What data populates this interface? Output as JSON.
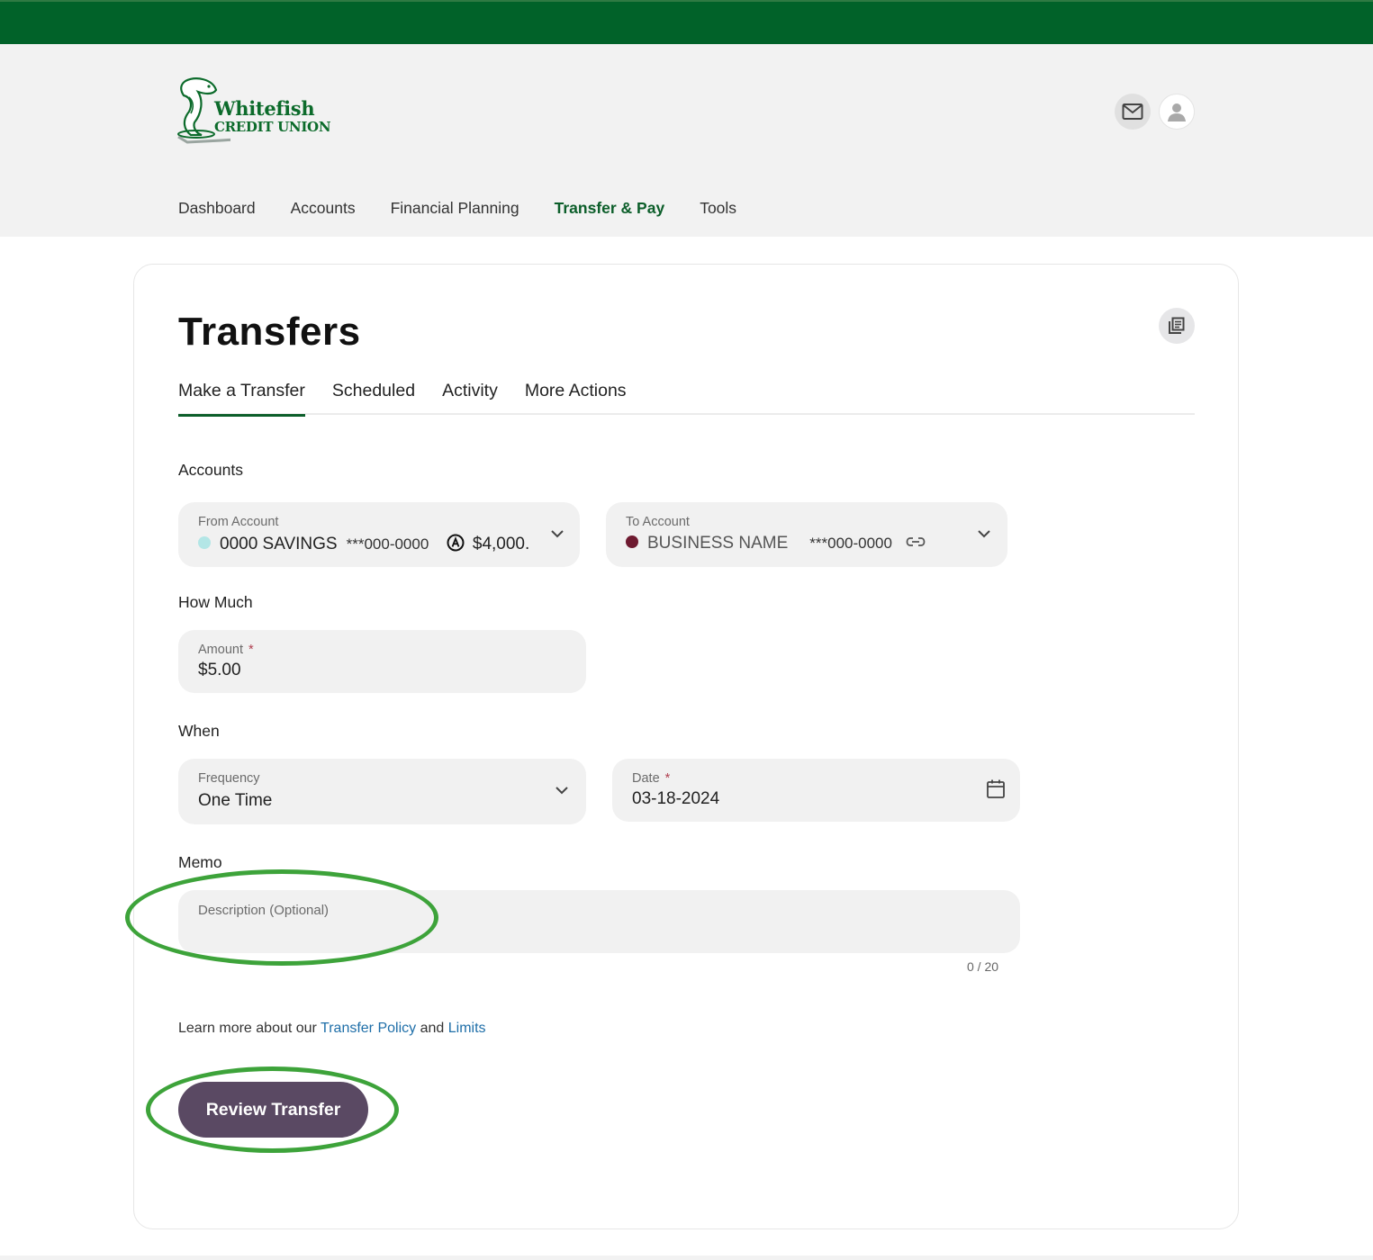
{
  "brand": {
    "name_line1": "Whitefish",
    "name_line2": "CREDIT UNION",
    "primary_color": "#016229",
    "button_color": "#5a4963",
    "link_color": "#1e6ea8"
  },
  "header": {
    "icons": [
      "mail-icon",
      "user-icon"
    ]
  },
  "nav": {
    "items": [
      {
        "label": "Dashboard",
        "active": false
      },
      {
        "label": "Accounts",
        "active": false
      },
      {
        "label": "Financial Planning",
        "active": false
      },
      {
        "label": "Transfer & Pay",
        "active": true
      },
      {
        "label": "Tools",
        "active": false
      }
    ]
  },
  "page": {
    "title": "Transfers",
    "tabs": [
      {
        "label": "Make a Transfer",
        "active": true
      },
      {
        "label": "Scheduled",
        "active": false
      },
      {
        "label": "Activity",
        "active": false
      },
      {
        "label": "More Actions",
        "active": false
      }
    ]
  },
  "form": {
    "accounts_label": "Accounts",
    "from_account": {
      "label": "From Account",
      "name": "0000 SAVINGS",
      "number": "***000-0000",
      "balance": "$4,000.",
      "dot_color": "#b3e6e6"
    },
    "to_account": {
      "label": "To Account",
      "name": "BUSINESS NAME",
      "number": "***000-0000",
      "dot_color": "#6e1a30"
    },
    "how_much_label": "How Much",
    "amount": {
      "label": "Amount",
      "required_mark": "*",
      "value": "$5.00"
    },
    "when_label": "When",
    "frequency": {
      "label": "Frequency",
      "value": "One Time"
    },
    "date": {
      "label": "Date",
      "required_mark": "*",
      "value": "03-18-2024"
    },
    "memo_label": "Memo",
    "memo": {
      "placeholder": "Description (Optional)",
      "value": "",
      "counter": "0 / 20"
    },
    "learn_more": {
      "prefix": "Learn more about our",
      "link1": "Transfer Policy",
      "middle": "and",
      "link2": "Limits"
    },
    "submit_label": "Review Transfer"
  },
  "annotations": {
    "highlight_color": "#3da33a",
    "highlighted": [
      "memo-field",
      "review-transfer-button"
    ]
  }
}
